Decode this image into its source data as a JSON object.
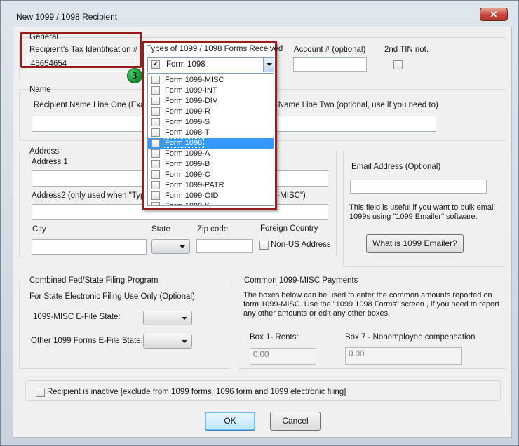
{
  "window": {
    "title": "New 1099 / 1098 Recipient",
    "close_glyph": "✕"
  },
  "general": {
    "group_label": "General",
    "tin_label": "Recipient's Tax Identification #",
    "tin_value": "45654654",
    "forms_label": "Types of 1099 / 1098 Forms Received",
    "account_label": "Account # (optional)",
    "account_value": "",
    "second_tin_label": "2nd TIN not."
  },
  "forms_dropdown": {
    "selected_value": "Form 1098",
    "items": [
      {
        "label": "Form 1099-MISC",
        "checked": false
      },
      {
        "label": "Form 1099-INT",
        "checked": false
      },
      {
        "label": "Form 1099-DIV",
        "checked": false
      },
      {
        "label": "Form 1099-R",
        "checked": false
      },
      {
        "label": "Form 1099-S",
        "checked": false
      },
      {
        "label": "Form 1098-T",
        "checked": false
      },
      {
        "label": "Form 1098",
        "checked": true,
        "highlighted": true
      },
      {
        "label": "Form 1099-A",
        "checked": false
      },
      {
        "label": "Form 1099-B",
        "checked": false
      },
      {
        "label": "Form 1099-C",
        "checked": false
      },
      {
        "label": "Form 1099-PATR",
        "checked": false
      },
      {
        "label": "Form 1099-OID",
        "checked": false
      },
      {
        "label": "Form 1099-K",
        "checked": false
      }
    ]
  },
  "step_badge": "3",
  "name": {
    "group_label": "Name",
    "line_one_label": "Recipient Name Line One (Exampl",
    "line_two_label": "nt Name Line Two (optional, use if you need to)"
  },
  "address": {
    "group_label": "Address",
    "address1_label": "Address 1",
    "address2_label": "Address2 (only used when \"Type",
    "address2_label_tail": "9-MISC\")",
    "city_label": "City",
    "state_label": "State",
    "zip_label": "Zip code",
    "foreign_label": "Foreign Country",
    "non_us_label": "Non-US Address"
  },
  "email": {
    "label": "Email Address (Optional)",
    "help_text": "This field is useful if you want to bulk email 1099s using \"1099 Emailer\" software.",
    "button_label": "What is 1099 Emailer?"
  },
  "fed_state": {
    "group_label": "Combined Fed/State Filing Program",
    "subtitle": "For State Electronic Filing Use Only (Optional)",
    "misc_label": "1099-MISC E-File State:",
    "other_label": "Other 1099 Forms E-File State:"
  },
  "misc_payments": {
    "group_label": "Common 1099-MISC Payments",
    "description": "The boxes below can be used to enter the common amounts reported on form 1099-MISC. Use the \"1099  1098 Forms\" screen , if you need to report any other amounts or edit any other boxes.",
    "box1_label": "Box 1- Rents:",
    "box1_value": "0.00",
    "box7_label": "Box 7 - Nonemployee compensation",
    "box7_value": "0.00"
  },
  "inactive_label": "Recipient is inactive [exclude from 1099 forms, 1096 form and 1099 electronic filing]",
  "buttons": {
    "ok": "OK",
    "cancel": "Cancel"
  },
  "colors": {
    "highlight_border": "#9b1b1b",
    "selection": "#3399ff",
    "badge": "#1fa845"
  }
}
